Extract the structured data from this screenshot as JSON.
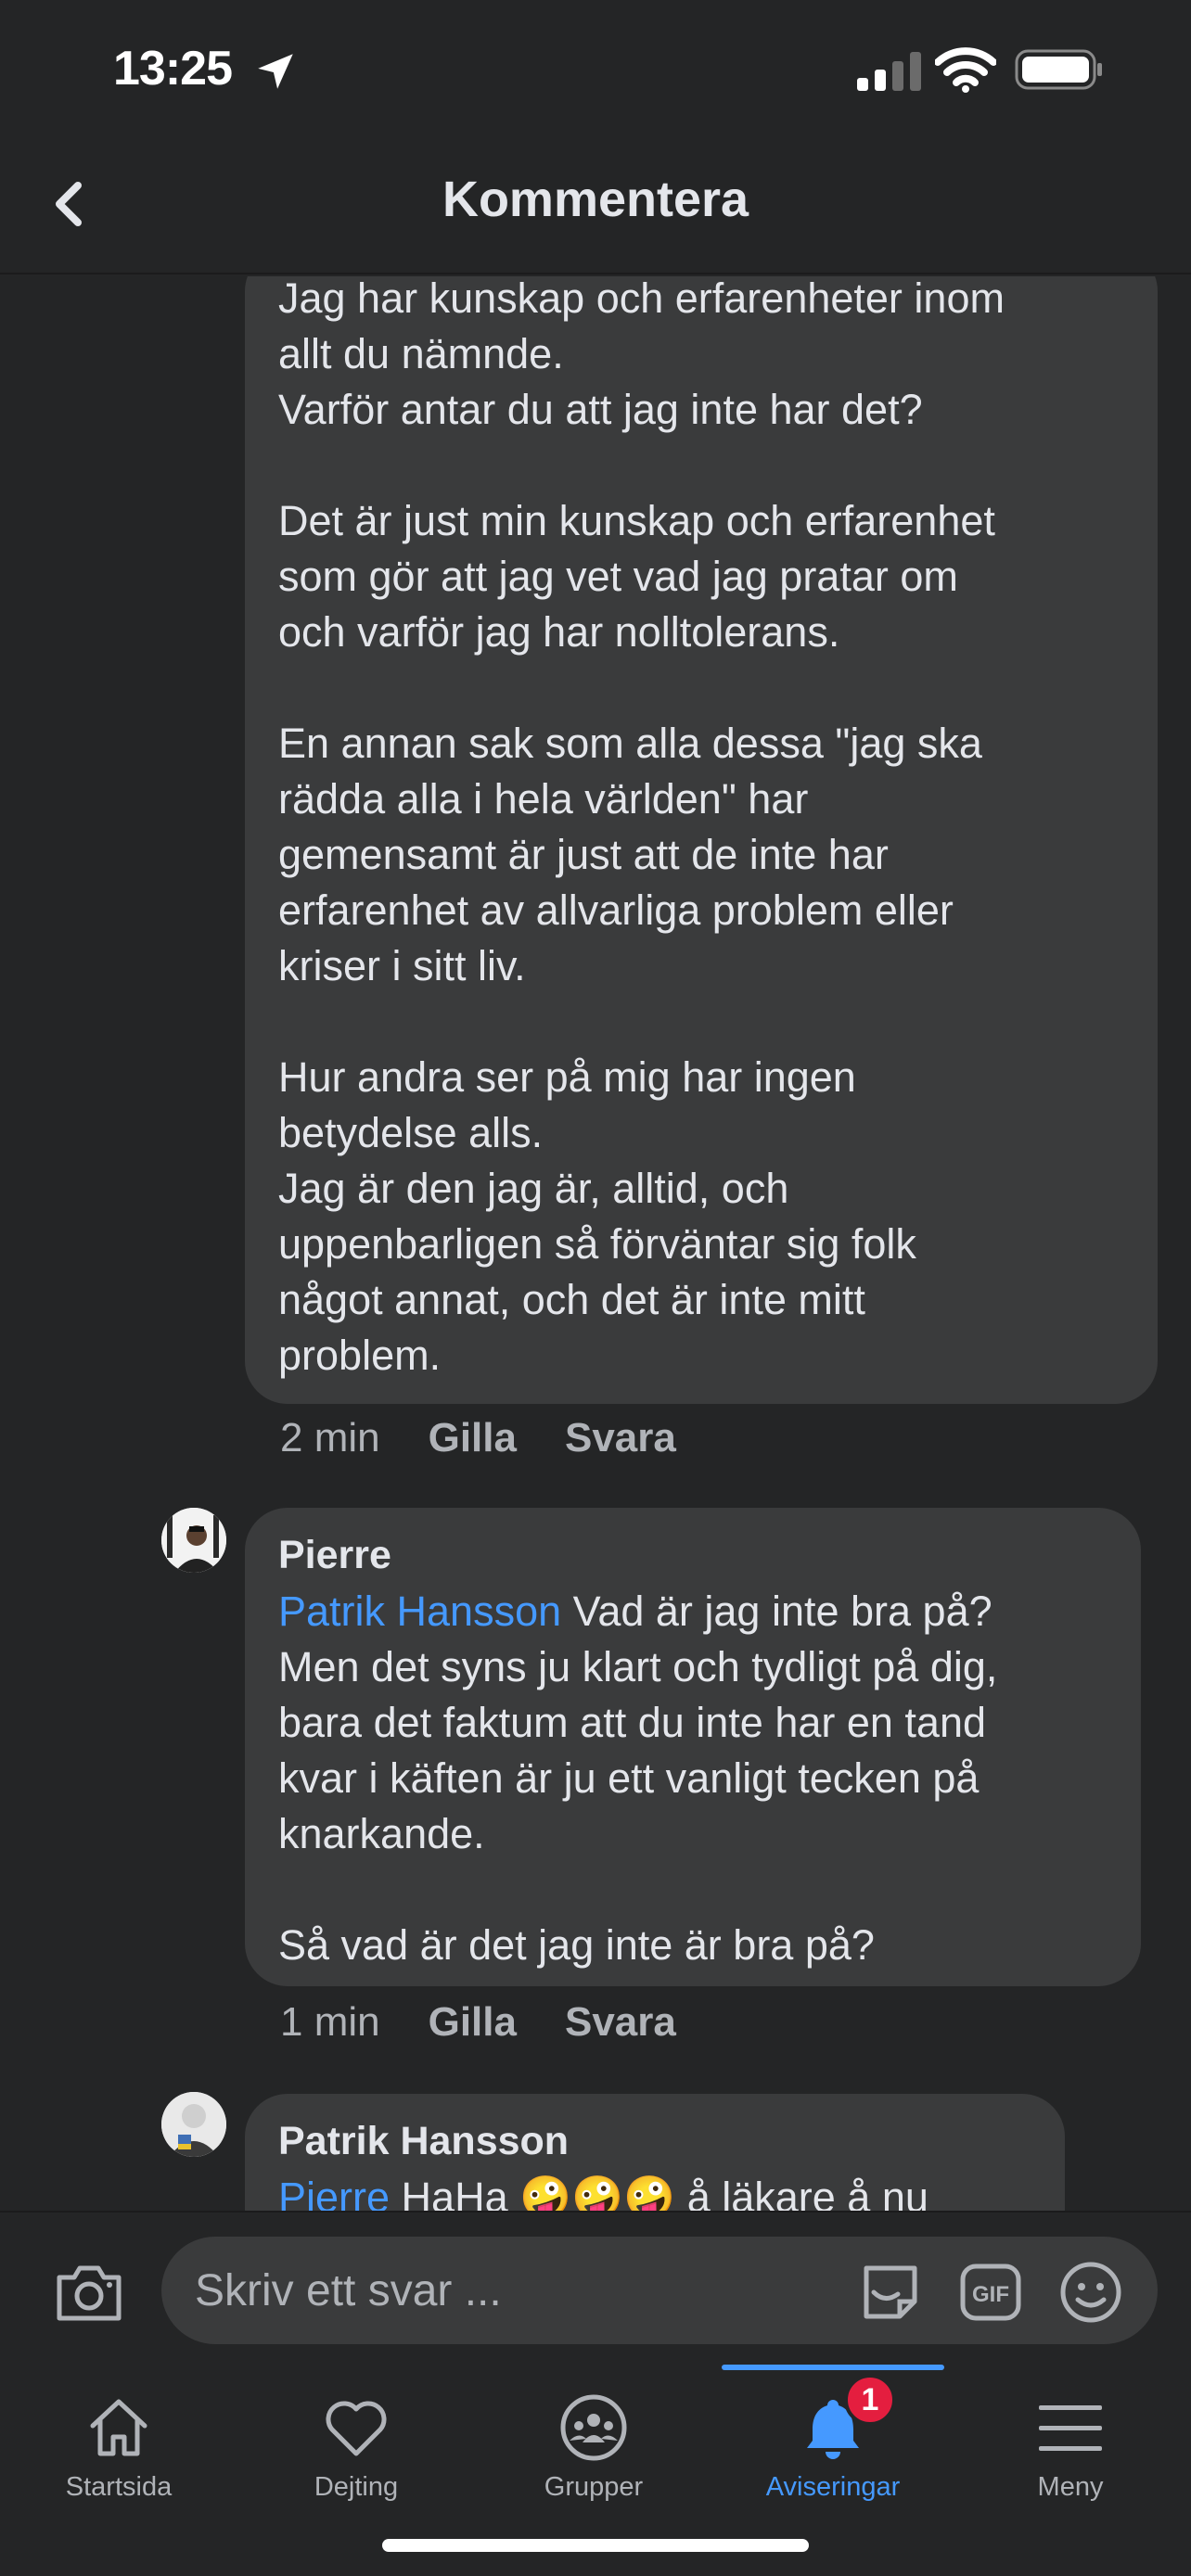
{
  "status_bar": {
    "time": "13:25"
  },
  "header": {
    "title": "Kommentera"
  },
  "comments": [
    {
      "author": "",
      "text": "Jag har kunskap och erfarenheter inom\nallt du nämnde.\nVarför antar du att jag inte har det?\n\nDet är just min kunskap och erfarenhet\nsom gör att jag vet vad jag pratar om\noch varför jag har nolltolerans.\n\nEn annan sak som alla dessa \"jag ska\nrädda alla i hela världen\" har\ngemensamt är just att de inte har\nerfarenhet av allvarliga problem eller\nkriser i sitt liv.\n\nHur andra ser på mig har ingen\nbetydelse alls.\nJag är den jag är, alltid, och\nuppenbarligen så förväntar sig folk\nnågot annat, och det är inte mitt\nproblem.",
      "time": "2 min",
      "like_label": "Gilla",
      "reply_label": "Svara"
    },
    {
      "author": "Pierre",
      "mention": "Patrik Hansson",
      "text": " Vad är jag inte bra på?\nMen det syns ju klart och tydligt på dig,\nbara det faktum att du inte har en tand\nkvar i käften är ju ett vanligt tecken på\nknarkande.\n\nSå vad är det jag inte är bra på?",
      "time": "1 min",
      "like_label": "Gilla",
      "reply_label": "Svara"
    },
    {
      "author": "Patrik Hansson",
      "mention": "Pierre",
      "text": " HaHa 🤪🤪🤪 å läkare å nu"
    }
  ],
  "composer": {
    "placeholder": "Skriv ett svar ..."
  },
  "tabs": [
    {
      "label": "Startsida",
      "icon": "home-icon"
    },
    {
      "label": "Dejting",
      "icon": "heart-icon"
    },
    {
      "label": "Grupper",
      "icon": "groups-icon"
    },
    {
      "label": "Aviseringar",
      "icon": "bell-icon",
      "badge": "1",
      "active": true
    },
    {
      "label": "Meny",
      "icon": "menu-icon"
    }
  ],
  "colors": {
    "accent": "#4599ff",
    "badge": "#e41e3f",
    "bubble": "#3a3b3c",
    "background": "#242526"
  }
}
